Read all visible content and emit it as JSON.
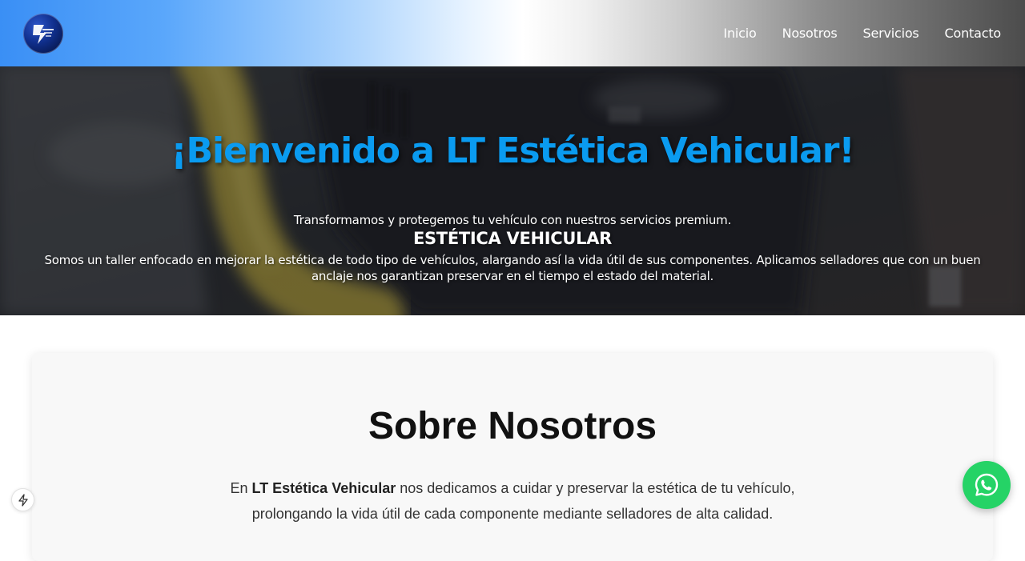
{
  "header": {
    "logo_icon": "lightning-logo-icon",
    "nav": [
      {
        "label": "Inicio"
      },
      {
        "label": "Nosotros"
      },
      {
        "label": "Servicios"
      },
      {
        "label": "Contacto"
      }
    ]
  },
  "hero": {
    "title": "¡Bienvenido a LT Estética Vehicular!",
    "tagline": "Transformamos y protegemos tu vehículo con nuestros servicios premium.",
    "subtitle": "ESTÉTICA VEHICULAR",
    "description": "Somos un taller enfocado en mejorar la estética de todo tipo de vehículos, alargando así la vida útil de sus componentes. Aplicamos selladores que con un buen anclaje nos garantizan preservar en el tiempo el estado del material."
  },
  "about": {
    "title": "Sobre Nosotros",
    "text_before": "En ",
    "text_brand": "LT Estética Vehicular",
    "text_after": " nos dedicamos a cuidar y preservar la estética de tu vehículo, prolongando la vida útil de cada componente mediante selladores de alta calidad."
  },
  "floating": {
    "bolt_icon": "lightning-bolt-icon",
    "whatsapp_icon": "whatsapp-icon"
  },
  "colors": {
    "accent": "#0a9bf0",
    "whatsapp": "#25d366",
    "header_start": "#3a8ff5",
    "header_end": "#4c4c4c"
  }
}
